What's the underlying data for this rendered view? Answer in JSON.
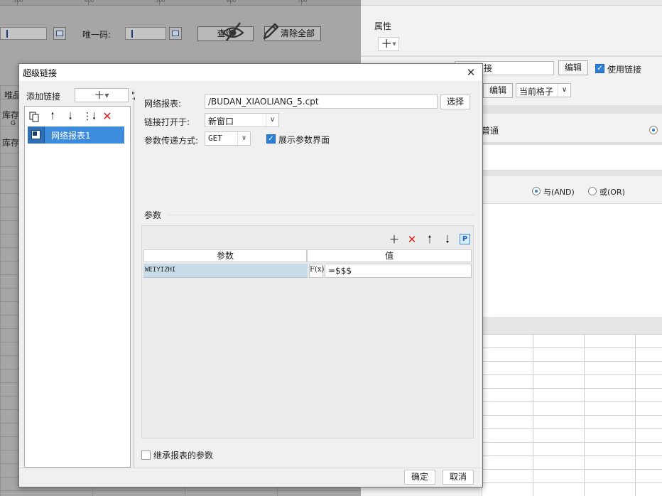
{
  "background": {
    "ruler_numbers": [
      "300",
      "400",
      "500",
      "600",
      "700"
    ],
    "unique_code_label": "唯一码:",
    "query_button": "查询",
    "clear_all_button": "清除全部",
    "grid_cells": [
      "唯品",
      "库存",
      "G",
      "库存"
    ]
  },
  "right_pane": {
    "properties_label": "属性",
    "link_field_value": "接",
    "edit_button_1": "编辑",
    "use_link_label": "使用链接",
    "edit_button_2": "编辑",
    "current_cell_select": "当前格子",
    "normal_label": "普通",
    "and_label": "与(AND)",
    "or_label": "或(OR)"
  },
  "dialog": {
    "title": "超级链接",
    "add_link_label": "添加链接",
    "link_items": [
      "网络报表1"
    ],
    "report_label": "网络报表:",
    "report_path": "/BUDAN_XIAOLIANG_5.cpt",
    "choose_button": "选择",
    "open_in_label": "链接打开于:",
    "open_in_value": "新窗口",
    "param_method_label": "参数传递方式:",
    "param_method_value": "GET",
    "show_param_ui_label": "展示参数界面",
    "params_section_title": "参数",
    "param_table": {
      "headers": [
        "参数",
        "值"
      ],
      "rows": [
        {
          "name": "WEIYIZHI",
          "fx": "F(x)",
          "value": "=$$$"
        }
      ]
    },
    "inherit_params_label": "继承报表的参数",
    "ok_button": "确定",
    "cancel_button": "取消"
  }
}
